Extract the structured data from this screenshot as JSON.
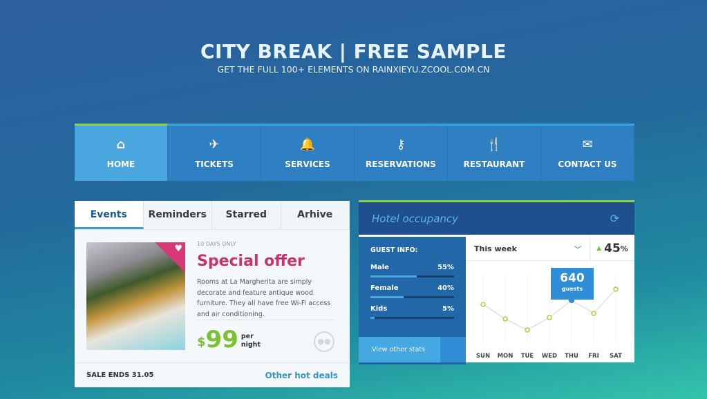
{
  "header": {
    "title": "CITY BREAK | FREE SAMPLE",
    "subtitle": "GET THE FULL 100+ ELEMENTS ON RAINXIEYU.ZCOOL.COM.CN"
  },
  "nav": [
    {
      "label": "HOME",
      "icon": "home-icon",
      "glyph": "⌂"
    },
    {
      "label": "TICKETS",
      "icon": "plane-icon",
      "glyph": "✈"
    },
    {
      "label": "SERVICES",
      "icon": "bell-icon",
      "glyph": "🔔"
    },
    {
      "label": "RESERVATIONS",
      "icon": "key-icon",
      "glyph": "⚷"
    },
    {
      "label": "RESTAURANT",
      "icon": "fork-knife-icon",
      "glyph": "🍴"
    },
    {
      "label": "CONTACT US",
      "icon": "envelope-icon",
      "glyph": "✉"
    }
  ],
  "events": {
    "tabs": [
      "Events",
      "Reminders",
      "Starred",
      "Arhive"
    ],
    "tag": "10 DAYS ONLY",
    "title": "Special offer",
    "description": "Rooms at La Margherita are simply decorate and feature antique wood furniture. They all have free Wi-Fi access and air conditioning.",
    "currency": "$",
    "price": "99",
    "per": "per",
    "unit": "night",
    "sale_ends": "SALE ENDS 31.05",
    "link": "Other hot deals"
  },
  "occupancy": {
    "title": "Hotel occupancy",
    "guest_title": "GUEST INFO:",
    "guests": [
      {
        "label": "Male",
        "value": "55%",
        "fill": 55
      },
      {
        "label": "Female",
        "value": "40%",
        "fill": 40
      },
      {
        "label": "Kids",
        "value": "5%",
        "fill": 5
      }
    ],
    "view_stats": "View other stats",
    "period": "This week",
    "change": "45",
    "change_unit": "%",
    "tooltip_value": "640",
    "tooltip_unit": "guests",
    "accent": "#8fcf4a"
  },
  "chart_data": {
    "type": "line",
    "categories": [
      "SUN",
      "MON",
      "TUE",
      "WED",
      "THU",
      "FRI",
      "SAT"
    ],
    "values": [
      583,
      386,
      235,
      405,
      640,
      461,
      790
    ],
    "highlight": "THU"
  }
}
